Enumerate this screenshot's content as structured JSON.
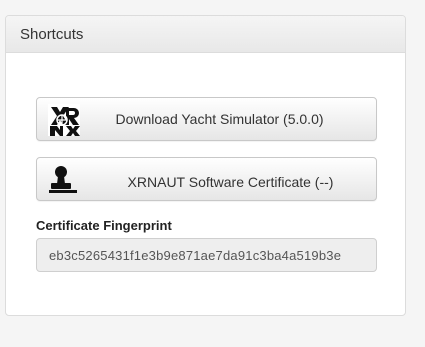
{
  "panel": {
    "title": "Shortcuts"
  },
  "shortcuts": {
    "download": {
      "label": "Download Yacht Simulator (5.0.0)",
      "icon": "xrnaut-logo-icon"
    },
    "certificate": {
      "label": "XRNAUT Software Certificate (--)",
      "icon": "stamp-icon"
    }
  },
  "fingerprint": {
    "label": "Certificate Fingerprint",
    "value": "eb3c5265431f1e3b9e871ae7da91c3ba4a519b3e"
  }
}
